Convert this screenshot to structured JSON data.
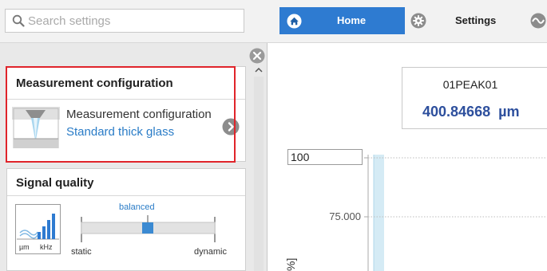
{
  "search": {
    "placeholder": "Search settings",
    "value": ""
  },
  "nav": {
    "home_label": "Home",
    "settings_label": "Settings",
    "active": "Home",
    "accent_color": "#2e7bd1"
  },
  "sidebar": {
    "measurement_card": {
      "title": "Measurement configuration",
      "item_name": "Measurement configuration",
      "item_value": "Standard thick glass",
      "highlight_color": "#e0242a"
    },
    "signal_card": {
      "title": "Signal quality",
      "icon_units": [
        "µm",
        "kHz"
      ],
      "slider_value_label": "balanced",
      "slider_min_label": "static",
      "slider_max_label": "dynamic",
      "slider_position": 0.5
    }
  },
  "peak": {
    "label": "01PEAK01",
    "value": "400.84668",
    "unit": "µm",
    "value_color": "#2d4f9d"
  },
  "chart_data": {
    "type": "bar",
    "ymax_input": "100",
    "ytick_labels": [
      "75.000"
    ],
    "ylabel_partial": "%]",
    "bar_color": "#d5ebf5",
    "grid": true
  }
}
